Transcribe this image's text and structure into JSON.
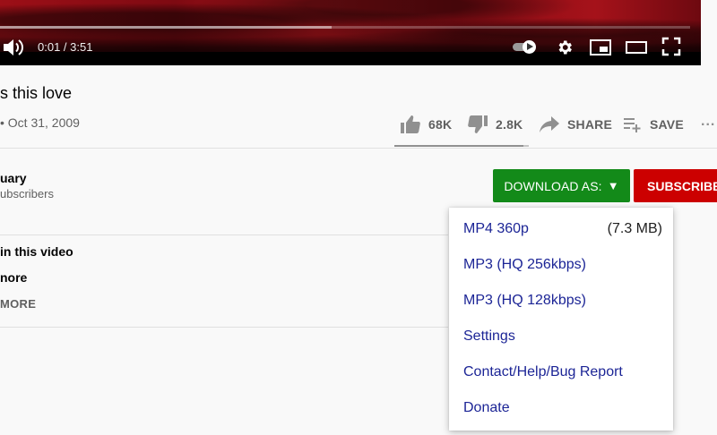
{
  "player": {
    "time_display": "0:01 / 3:51",
    "progress_loaded": 0.48,
    "autoplay_on": true
  },
  "video": {
    "title": "s this love",
    "meta": "• Oct 31, 2009"
  },
  "actions": {
    "like_count": "68K",
    "dislike_count": "2.8K",
    "share_label": "SHARE",
    "save_label": "SAVE",
    "more_label": "...",
    "like_ratio": 0.96
  },
  "channel": {
    "name": "uary",
    "subscribers": "ubscribers"
  },
  "buttons": {
    "download_label": "DOWNLOAD AS:",
    "download_arrow": "▼",
    "subscribe_label": "SUBSCRIBE"
  },
  "description": {
    "line1": "in this video",
    "line2": "nore",
    "show_more": "MORE"
  },
  "download_menu": {
    "items": [
      {
        "label": "MP4 360p",
        "size": "(7.3 MB)"
      },
      {
        "label": "MP3 (HQ 256kbps)",
        "size": ""
      },
      {
        "label": "MP3 (HQ 128kbps)",
        "size": ""
      },
      {
        "label": "Settings",
        "size": ""
      },
      {
        "label": "Contact/Help/Bug Report",
        "size": ""
      },
      {
        "label": "Donate",
        "size": ""
      }
    ]
  },
  "colors": {
    "download_green": "#138a19",
    "subscribe_red": "#cc0000",
    "menu_link_blue": "#1c2596"
  },
  "icons": [
    "volume-icon",
    "autoplay-toggle",
    "settings-gear-icon",
    "miniplayer-icon",
    "theater-mode-icon",
    "fullscreen-icon",
    "thumbs-up-icon",
    "thumbs-down-icon",
    "share-arrow-icon",
    "add-to-playlist-icon"
  ]
}
